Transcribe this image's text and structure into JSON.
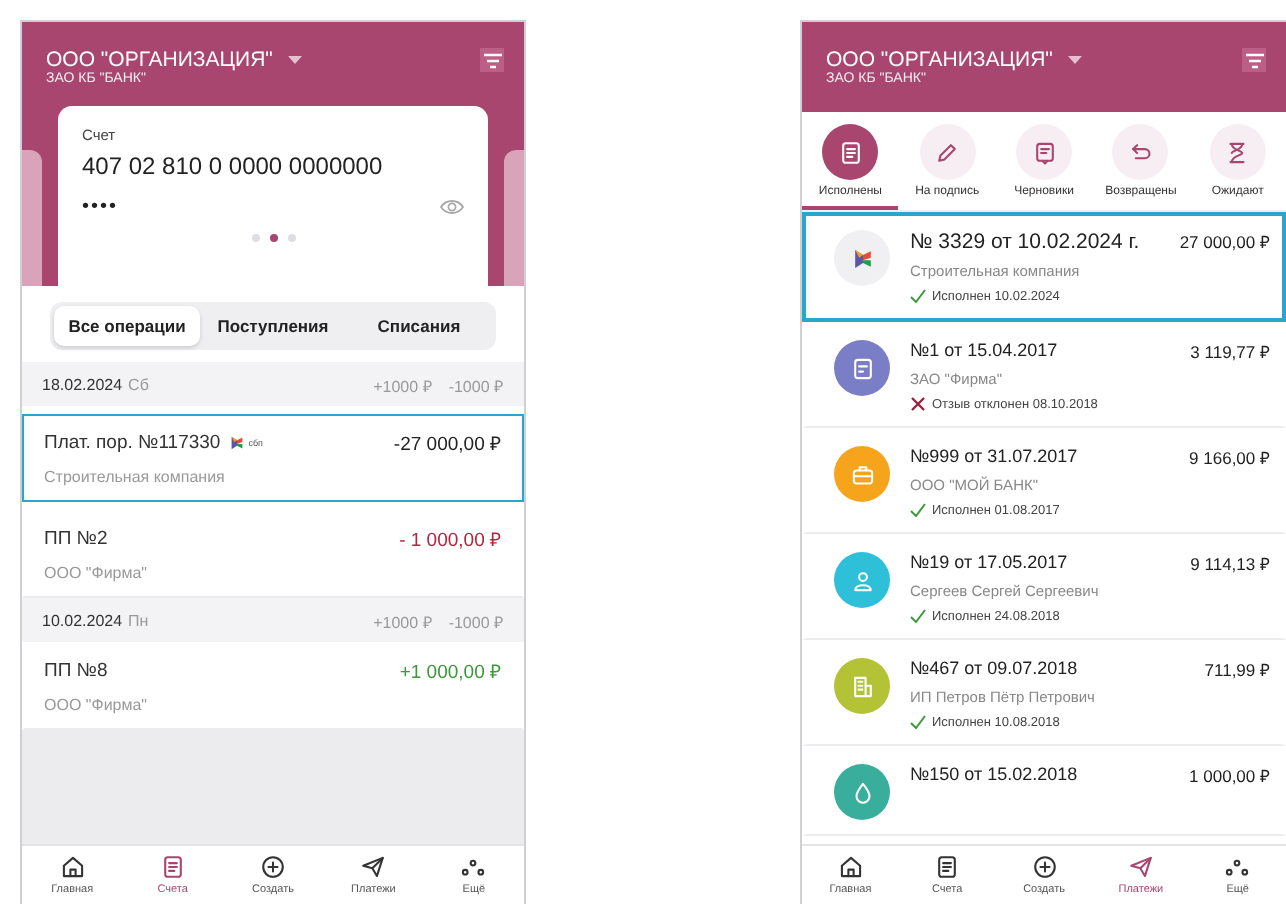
{
  "left_screen": {
    "header": {
      "organization": "ООО \"ОРГАНИЗАЦИЯ\"",
      "bank": "ЗАО КБ \"БАНК\""
    },
    "account_card": {
      "label": "Счет",
      "number": "407 02 810 0 0000 0000000",
      "masked_balance": "••••",
      "pager": [
        {
          "selected": false
        },
        {
          "selected": true
        },
        {
          "selected": false
        }
      ]
    },
    "filter_tabs": [
      {
        "label": "Все операции",
        "selected": true
      },
      {
        "label": "Поступления",
        "selected": false
      },
      {
        "label": "Списания",
        "selected": false
      }
    ],
    "operations": [
      {
        "kind": "date",
        "date": "18.02.2024",
        "weekday": "Сб",
        "income": "+1000 ₽",
        "expense": "-1000 ₽"
      },
      {
        "kind": "operation",
        "title": "Плат. пор. №117330",
        "badge": "сбп",
        "amount": "-27 000,00 ₽",
        "color": "#222222",
        "counterparty": "Строительная компания",
        "selected": true
      },
      {
        "kind": "operation",
        "title": "ПП №2",
        "amount": "- 1 000,00 ₽",
        "color": "#b3263e",
        "counterparty": "ООО \"Фирма\"",
        "selected": false
      },
      {
        "kind": "date",
        "date": "10.02.2024",
        "weekday": "Пн",
        "income": "+1000 ₽",
        "expense": "-1000 ₽"
      },
      {
        "kind": "operation",
        "title": "ПП №8",
        "amount": "+1 000,00 ₽",
        "color": "#3a9a3a",
        "counterparty": "ООО \"Фирма\"",
        "selected": false
      }
    ],
    "nav": [
      {
        "kind": "home",
        "label": "Главная",
        "selected": false
      },
      {
        "kind": "document",
        "label": "Счета",
        "selected": true
      },
      {
        "kind": "plus",
        "label": "Создать",
        "selected": false
      },
      {
        "kind": "plane",
        "label": "Платежи",
        "selected": false
      },
      {
        "kind": "dots",
        "label": "Ещё",
        "selected": false
      }
    ]
  },
  "right_screen": {
    "header": {
      "organization": "ООО \"ОРГАНИЗАЦИЯ\"",
      "bank": "ЗАО КБ \"БАНК\""
    },
    "status_tabs": [
      {
        "kind": "document",
        "label": "Исполнены",
        "selected": true
      },
      {
        "kind": "pencil",
        "label": "На подпись",
        "selected": false
      },
      {
        "kind": "draft",
        "label": "Черновики",
        "selected": false
      },
      {
        "kind": "return",
        "label": "Возвращены",
        "selected": false
      },
      {
        "kind": "hourglass",
        "label": "Ожидают",
        "selected": false
      }
    ],
    "documents": [
      {
        "avatar": {
          "kind": "sbp",
          "color": "#f0f0f2"
        },
        "title": "№ 3329 от 10.02.2024 г.",
        "amount": "27 000,00 ₽",
        "counterparty": "Строительная компания",
        "status": {
          "kind": "done",
          "text": "Исполнен 10.02.2024"
        },
        "selected": true
      },
      {
        "avatar": {
          "kind": "form",
          "color": "#7a7ec6"
        },
        "title": "№1 от 15.04.2017",
        "amount": "3 119,77 ₽",
        "counterparty": "ЗАО \"Фирма\"",
        "status": {
          "kind": "rejected",
          "text": "Отзыв отклонен 08.10.2018"
        },
        "selected": false
      },
      {
        "avatar": {
          "kind": "briefcase",
          "color": "#f5a41c"
        },
        "title": "№999 от 31.07.2017",
        "amount": "9 166,00 ₽",
        "counterparty": "ООО \"МОЙ БАНК\"",
        "status": {
          "kind": "done",
          "text": "Исполнен 01.08.2017"
        },
        "selected": false
      },
      {
        "avatar": {
          "kind": "person",
          "color": "#2ec0d8"
        },
        "title": "№19 от 17.05.2017",
        "amount": "9 114,13 ₽",
        "counterparty": "Сергеев Сергей Сергеевич",
        "status": {
          "kind": "done",
          "text": "Исполнен 24.08.2018"
        },
        "selected": false
      },
      {
        "avatar": {
          "kind": "building",
          "color": "#b4c236"
        },
        "title": "№467 от 09.07.2018",
        "amount": "711,99 ₽",
        "counterparty": "ИП Петров Пётр Петрович",
        "status": {
          "kind": "done",
          "text": "Исполнен 10.08.2018"
        },
        "selected": false
      },
      {
        "avatar": {
          "kind": "drop",
          "color": "#3aae9c"
        },
        "title": "№150 от 15.02.2018",
        "amount": "1 000,00 ₽",
        "selected": false
      }
    ],
    "nav": [
      {
        "kind": "home",
        "label": "Главная",
        "selected": false
      },
      {
        "kind": "document",
        "label": "Счета",
        "selected": false
      },
      {
        "kind": "plus",
        "label": "Создать",
        "selected": false
      },
      {
        "kind": "plane",
        "label": "Платежи",
        "selected": true
      },
      {
        "kind": "dots",
        "label": "Ещё",
        "selected": false
      }
    ]
  }
}
